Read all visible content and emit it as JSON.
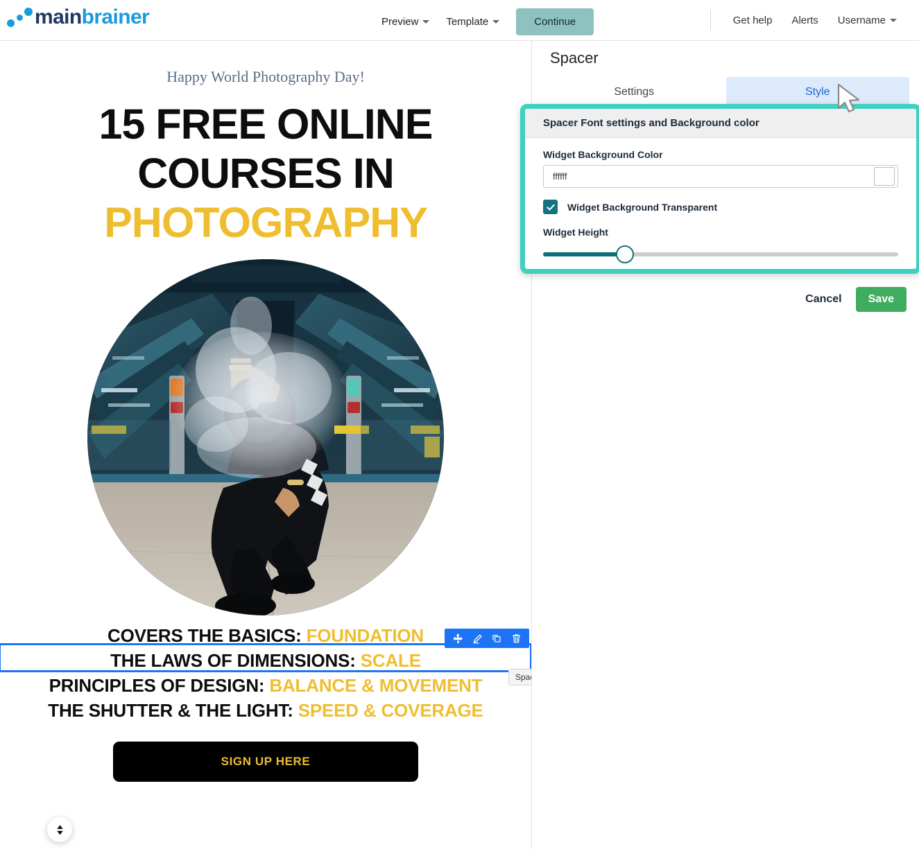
{
  "brand": {
    "name_part1": "main",
    "name_part2": "brainer",
    "accent": "#1A9BDC",
    "dark": "#1F3864"
  },
  "topbar": {
    "nav": [
      {
        "label": "Preview",
        "icon": "chevron-down-icon",
        "has_caret": true
      },
      {
        "label": "Template",
        "icon": "chevron-down-icon",
        "has_caret": true
      }
    ],
    "continue_label": "Continue",
    "continue_color": "#8DC2BE",
    "right_links": [
      {
        "label": "Get help",
        "has_caret": false
      },
      {
        "label": "Alerts",
        "has_caret": false
      },
      {
        "label": "Username",
        "has_caret": true
      }
    ]
  },
  "email": {
    "preheader": "Happy World Photography Day!",
    "headline_line1": "15 FREE ONLINE",
    "headline_line2": "COURSES IN",
    "headline_line3": "PHOTOGRAPHY",
    "headline_accent": "#EFBE30",
    "image_alt": "photographer-crouching-with-camera-in-subway",
    "bullets": [
      {
        "label": "COVERS THE BASICS:",
        "value": "FOUNDATION"
      },
      {
        "label": "THE LAWS OF DIMENSIONS:",
        "value": "SCALE"
      },
      {
        "label": "PRINCIPLES OF DESIGN:",
        "value": "BALANCE & MOVEMENT"
      },
      {
        "label": "THE SHUTTER & THE LIGHT:",
        "value": "SPEED & COVERAGE"
      }
    ],
    "cta_label": "SIGN UP HERE",
    "cta_bg": "#000000",
    "cta_text_color": "#EFBE30"
  },
  "selection": {
    "widget_tag": "Spacer",
    "border_color": "#1D74F5",
    "toolbar": [
      {
        "icon": "move-icon",
        "name": "move-widget"
      },
      {
        "icon": "pencil-icon",
        "name": "edit-widget"
      },
      {
        "icon": "duplicate-icon",
        "name": "duplicate-widget"
      },
      {
        "icon": "trash-icon",
        "name": "delete-widget"
      }
    ]
  },
  "panel": {
    "title": "Spacer",
    "tabs": [
      {
        "label": "Settings",
        "active": false
      },
      {
        "label": "Style",
        "active": true
      }
    ],
    "highlight_color": "#3ED0C0",
    "section_header": "Spacer Font settings and Background color",
    "background_color_label": "Widget Background Color",
    "background_color_value": "ffffff",
    "background_color_placeholder": "ffffff",
    "swatch_color": "#ffffff",
    "transparent_label": "Widget Background Transparent",
    "transparent_checked": true,
    "checkbox_color": "#12737E",
    "height_label": "Widget Height",
    "height_percent": "23",
    "slider_fill_color": "#0D6E78",
    "cancel_label": "Cancel",
    "save_label": "Save",
    "save_color": "#40AC5F"
  },
  "overlay": {
    "cursor": "arrow-cursor",
    "reorder_button": "up-down-arrows-icon"
  }
}
